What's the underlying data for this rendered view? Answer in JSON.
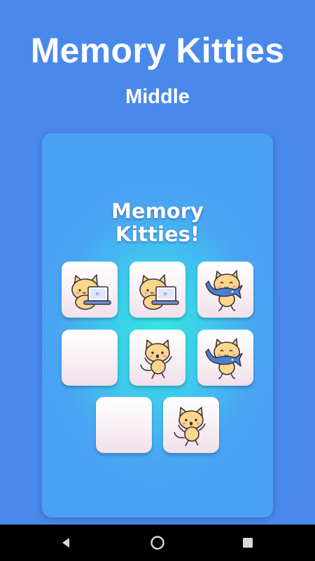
{
  "header": {
    "title": "Memory Kitties",
    "level": "Middle"
  },
  "board": {
    "title_line1": "Memory",
    "title_line2": "Kitties!",
    "cards": [
      {
        "state": "revealed",
        "icon": "kitty-laptop-icon"
      },
      {
        "state": "revealed",
        "icon": "kitty-laptop-icon"
      },
      {
        "state": "revealed",
        "icon": "kitty-fish-icon"
      },
      {
        "state": "hidden",
        "icon": "card-back"
      },
      {
        "state": "revealed",
        "icon": "kitty-dancing-icon"
      },
      {
        "state": "revealed",
        "icon": "kitty-fish-icon"
      },
      {
        "state": "hidden",
        "icon": "card-back"
      },
      {
        "state": "revealed",
        "icon": "kitty-dancing-icon"
      }
    ]
  },
  "navbar": {
    "buttons": [
      "back-icon",
      "home-icon",
      "recents-icon"
    ]
  },
  "colors": {
    "background": "#4a89ec",
    "board_glow": "#2fe8df",
    "board_edge": "#4aa0f4",
    "cat_fur": "#fcd68a",
    "cat_outline": "#3a3340",
    "laptop": "#6f8cd8",
    "fish": "#4b7fd1"
  }
}
